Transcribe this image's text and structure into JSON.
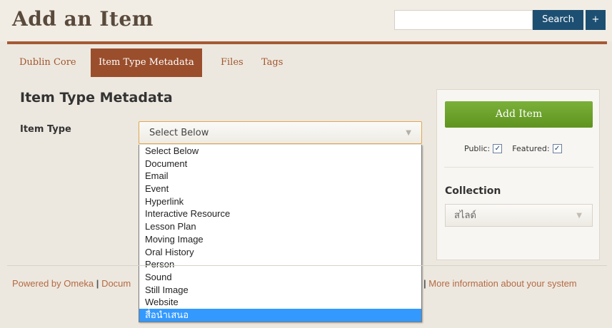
{
  "header": {
    "title": "Add an Item",
    "search_placeholder": "",
    "search_label": "Search",
    "advanced_label": "+"
  },
  "tabs": [
    {
      "label": "Dublin Core",
      "active": false
    },
    {
      "label": "Item Type Metadata",
      "active": true
    },
    {
      "label": "Files",
      "active": false
    },
    {
      "label": "Tags",
      "active": false
    }
  ],
  "main": {
    "section_title": "Item Type Metadata",
    "item_type_label": "Item Type",
    "item_type_selected": "Select Below",
    "item_type_options": [
      "Select Below",
      "Document",
      "Email",
      "Event",
      "Hyperlink",
      "Interactive Resource",
      "Lesson Plan",
      "Moving Image",
      "Oral History",
      "Person",
      "Sound",
      "Still Image",
      "Website",
      "สื่อนำเสนอ"
    ],
    "highlighted_option": "สื่อนำเสนอ"
  },
  "sidebar": {
    "add_item_label": "Add Item",
    "public_label": "Public:",
    "public_checked": true,
    "featured_label": "Featured:",
    "featured_checked": true,
    "collection_label": "Collection",
    "collection_selected": "สไลด์"
  },
  "footer": {
    "powered_by": "Powered by Omeka",
    "separator": "|",
    "documentation_partial": "Docum",
    "more_info": "More information about your system"
  },
  "colors": {
    "accent": "#9a4e2c",
    "link": "#b36a44",
    "search_button": "#1d4f72",
    "add_button": "#6ba22b",
    "highlight": "#3399ff"
  }
}
